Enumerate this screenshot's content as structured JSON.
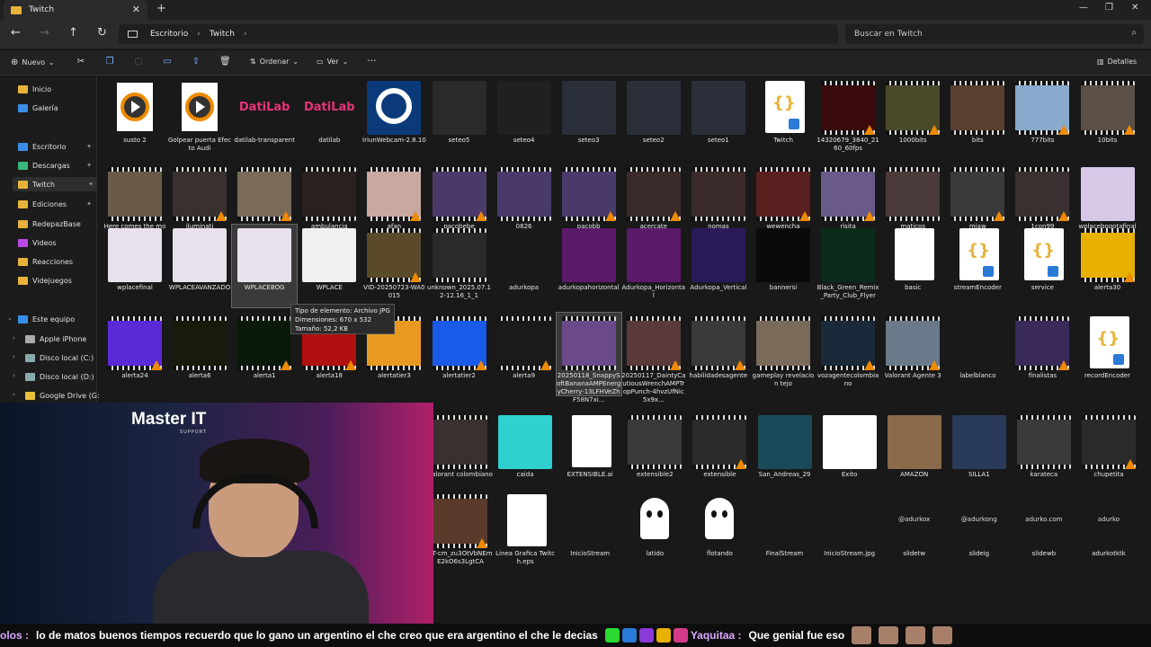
{
  "window": {
    "tab_title": "Twitch",
    "new_tab": "+",
    "close_tab": "✕"
  },
  "address": {
    "breadcrumbs": [
      "Escritorio",
      "Twitch"
    ],
    "search_placeholder": "Buscar en Twitch"
  },
  "toolbar": {
    "new_label": "Nuevo",
    "sort_label": "Ordenar",
    "view_label": "Ver",
    "more_label": "···",
    "details_label": "Detalles"
  },
  "sidebar": {
    "items": [
      {
        "label": "Inicio",
        "color": "#e8b33a"
      },
      {
        "label": "Galería",
        "color": "#3a8ee8"
      },
      {
        "label": "Escritorio",
        "color": "#3a8ee8"
      },
      {
        "label": "Descargas",
        "color": "#3ab87a"
      },
      {
        "label": "Twitch",
        "color": "#e8b33a"
      },
      {
        "label": "Ediciones",
        "color": "#e8b33a"
      },
      {
        "label": "RedepazBase",
        "color": "#e8b33a"
      },
      {
        "label": "Videos",
        "color": "#b94ae8"
      },
      {
        "label": "Reacciones",
        "color": "#e8b33a"
      },
      {
        "label": "Videjuegos",
        "color": "#e8b33a"
      },
      {
        "label": "Este equipo",
        "color": "#3a8ee8"
      },
      {
        "label": "Apple iPhone",
        "color": "#aaa"
      },
      {
        "label": "Disco local (C:)",
        "color": "#8aa"
      },
      {
        "label": "Disco local (D:)",
        "color": "#8aa"
      },
      {
        "label": "Google Drive (G:)",
        "color": "#e8c33a"
      }
    ]
  },
  "files": [
    {
      "name": "susto 2",
      "thumb": "#ffffff",
      "kind": "play"
    },
    {
      "name": "Golpear puerta Efecto Audi",
      "thumb": "#ffffff",
      "kind": "play"
    },
    {
      "name": "datilab-transparent",
      "thumb": "#191919",
      "kind": "datilab"
    },
    {
      "name": "datilab",
      "thumb": "#191919",
      "kind": "datilab"
    },
    {
      "name": "IriunWebcam-2.8.10",
      "thumb": "#0a3a7a",
      "kind": "iriun"
    },
    {
      "name": "seteo5",
      "thumb": "#2a2a2a",
      "kind": "shot"
    },
    {
      "name": "seteo4",
      "thumb": "#202020",
      "kind": "shot"
    },
    {
      "name": "seteo3",
      "thumb": "#2a2f3a",
      "kind": "shot"
    },
    {
      "name": "seteo2",
      "thumb": "#2a2f3a",
      "kind": "shot"
    },
    {
      "name": "seteo1",
      "thumb": "#2a2f3a",
      "kind": "shot"
    },
    {
      "name": "Twitch",
      "thumb": "#ffffff",
      "kind": "json"
    },
    {
      "name": "14320679_3840_2160_60fps",
      "thumb": "#3a0a0a",
      "kind": "video"
    },
    {
      "name": "1000bits",
      "thumb": "#4a4a2a",
      "kind": "video"
    },
    {
      "name": "bits",
      "thumb": "#5a4030",
      "kind": "video"
    },
    {
      "name": "777bits",
      "thumb": "#88aacc",
      "kind": "video"
    },
    {
      "name": "10bits",
      "thumb": "#5a5048",
      "kind": "video"
    },
    {
      "name": "Here comes the money - meme",
      "thumb": "#6a5a4a",
      "kind": "video"
    },
    {
      "name": "iluminati",
      "thumb": "#3a3030",
      "kind": "video"
    },
    {
      "name": "cagada",
      "thumb": "#7a6a5a",
      "kind": "video"
    },
    {
      "name": "ambulancia",
      "thumb": "#2a2020",
      "kind": "video"
    },
    {
      "name": "afan",
      "thumb": "#c8a8a0",
      "kind": "video"
    },
    {
      "name": "pacobebe",
      "thumb": "#4a3a6a",
      "kind": "video"
    },
    {
      "name": "0826",
      "thumb": "#4a3a6a",
      "kind": "video"
    },
    {
      "name": "pacobb",
      "thumb": "#4a3a6a",
      "kind": "video"
    },
    {
      "name": "acercate",
      "thumb": "#3a2a2a",
      "kind": "video"
    },
    {
      "name": "nomas",
      "thumb": "#3a2a2a",
      "kind": "video"
    },
    {
      "name": "wewencha",
      "thumb": "#5a2020",
      "kind": "video"
    },
    {
      "name": "risita",
      "thumb": "#6a5a8a",
      "kind": "video"
    },
    {
      "name": "maticos",
      "thumb": "#4a3a3a",
      "kind": "video"
    },
    {
      "name": "miaw",
      "thumb": "#3a3a3a",
      "kind": "video"
    },
    {
      "name": "1con99",
      "thumb": "#3a3030",
      "kind": "video"
    },
    {
      "name": "wplacebogotafinal",
      "thumb": "#d8c8e8",
      "kind": "image"
    },
    {
      "name": "wplacefinal",
      "thumb": "#e8e0ea",
      "kind": "image"
    },
    {
      "name": "WPLACEAVANZADO",
      "thumb": "#e8e0ea",
      "kind": "image"
    },
    {
      "name": "WPLACEBOG",
      "thumb": "#e8e0ea",
      "kind": "image",
      "selected": true
    },
    {
      "name": "WPLACE",
      "thumb": "#f0f0f0",
      "kind": "image"
    },
    {
      "name": "VID-20250723-WA0015",
      "thumb": "#5a4a2a",
      "kind": "video"
    },
    {
      "name": "unknown_2025.07.12-12.16_1_1",
      "thumb": "#2a2a2a",
      "kind": "video"
    },
    {
      "name": "adurkopa",
      "thumb": "#191919",
      "kind": "image"
    },
    {
      "name": "adurkopahorizontal",
      "thumb": "#5a1a6a",
      "kind": "image"
    },
    {
      "name": "Adurkopa_Horizontal",
      "thumb": "#5a1a6a",
      "kind": "image"
    },
    {
      "name": "Adurkopa_Vertical",
      "thumb": "#2a1a5a",
      "kind": "image"
    },
    {
      "name": "bannersi",
      "thumb": "#0a0a0a",
      "kind": "image"
    },
    {
      "name": "Black_Green_Remix_Party_Club_Flyer",
      "thumb": "#0a2a1a",
      "kind": "image"
    },
    {
      "name": "basic",
      "thumb": "#ffffff",
      "kind": "doc"
    },
    {
      "name": "streamEncoder",
      "thumb": "#ffffff",
      "kind": "json"
    },
    {
      "name": "service",
      "thumb": "#ffffff",
      "kind": "json"
    },
    {
      "name": "alerta30",
      "thumb": "#e8b000",
      "kind": "video"
    },
    {
      "name": "alerta24",
      "thumb": "#5a2ad8",
      "kind": "video"
    },
    {
      "name": "alerta6",
      "thumb": "#1a1a0a",
      "kind": "video"
    },
    {
      "name": "alerta1",
      "thumb": "#0a1a0a",
      "kind": "video"
    },
    {
      "name": "alerta18",
      "thumb": "#b01010",
      "kind": "video"
    },
    {
      "name": "alertatier3",
      "thumb": "#e89a20",
      "kind": "video"
    },
    {
      "name": "alertatier2",
      "thumb": "#1a5ae8",
      "kind": "video"
    },
    {
      "name": "alerta9",
      "thumb": "#1a1a1a",
      "kind": "video"
    },
    {
      "name": "20250118_SnappySoftBananaAMPEnergyCherry-13LFHVeZhF58N7xi...",
      "thumb": "#6a4a8a",
      "kind": "video",
      "selected": true
    },
    {
      "name": "20250117_DaintyCautiousWrenchAMPTropPunch-4hvzUfNic5x9x...",
      "thumb": "#5a3a3a",
      "kind": "video"
    },
    {
      "name": "habilidadesagente",
      "thumb": "#3a3a3a",
      "kind": "video"
    },
    {
      "name": "gameplay revelacion tejo",
      "thumb": "#7a6a5a",
      "kind": "video"
    },
    {
      "name": "vozagentecolombiano",
      "thumb": "#1a2a3a",
      "kind": "video"
    },
    {
      "name": "Valorant Agente 3",
      "thumb": "#6a7a8a",
      "kind": "video"
    },
    {
      "name": "labelblanco",
      "thumb": "#191919",
      "kind": "image"
    },
    {
      "name": "finalistas",
      "thumb": "#3a2a5a",
      "kind": "video"
    },
    {
      "name": "recordEncoder",
      "thumb": "#ffffff",
      "kind": "json"
    },
    {
      "name": "valorant colombiano",
      "thumb": "#3a3030",
      "kind": "video"
    },
    {
      "name": "caida",
      "thumb": "#30d0d0",
      "kind": "image"
    },
    {
      "name": "EXTENSIBLE.ai",
      "thumb": "#ffffff",
      "kind": "doc"
    },
    {
      "name": "extensible2",
      "thumb": "#3a3a3a",
      "kind": "video"
    },
    {
      "name": "extensible",
      "thumb": "#2a2a2a",
      "kind": "video"
    },
    {
      "name": "San_Andreas_29",
      "thumb": "#1a4a5a",
      "kind": "image"
    },
    {
      "name": "Exito",
      "thumb": "#ffffff",
      "kind": "image"
    },
    {
      "name": "AMAZON",
      "thumb": "#8a6a4a",
      "kind": "image"
    },
    {
      "name": "SILLA1",
      "thumb": "#2a3a5a",
      "kind": "image"
    },
    {
      "name": "karateca",
      "thumb": "#3a3a3a",
      "kind": "video"
    },
    {
      "name": "chupetita",
      "thumb": "#2a2a2a",
      "kind": "video"
    },
    {
      "name": "AT-cm_zu3OtVbNEmE2kO6s3LgtCA",
      "thumb": "#5a3a2a",
      "kind": "video"
    },
    {
      "name": "Linea Grafica Twitch.eps",
      "thumb": "#ffffff",
      "kind": "doc"
    },
    {
      "name": "InicioStream",
      "thumb": "#191919",
      "kind": "image"
    },
    {
      "name": "latido",
      "thumb": "#191919",
      "kind": "ghost"
    },
    {
      "name": "flotando",
      "thumb": "#191919",
      "kind": "ghost"
    },
    {
      "name": "FinalStream",
      "thumb": "#191919",
      "kind": "image"
    },
    {
      "name": "InicioStream.jpg",
      "thumb": "#191919",
      "kind": "image"
    },
    {
      "name": "slidetw",
      "thumb": "#191919",
      "kind": "image",
      "caption": "@adurkox"
    },
    {
      "name": "slideig",
      "thumb": "#191919",
      "kind": "image",
      "caption": "@adurkong"
    },
    {
      "name": "slidewb",
      "thumb": "#191919",
      "kind": "image",
      "caption": "adurko.com"
    },
    {
      "name": "adurkotktk",
      "thumb": "#191919",
      "kind": "image",
      "caption": "adurko"
    }
  ],
  "tooltip": {
    "line1": "Tipo de elemento: Archivo JPG",
    "line2": "Dimensiones: 670 x 532",
    "line3": "Tamaño: 52,2 KB"
  },
  "overlay": {
    "brand": "Master IT",
    "brand_sub": "SUPPORT"
  },
  "ticker": {
    "segments": [
      {
        "text": "olos :",
        "user": true
      },
      {
        "text": "lo de matos  buenos tiempos  recuerdo que lo gano un argentino  el che creo que era  argentino el che le decias",
        "user": false
      },
      {
        "text": "Yaquitaa :",
        "user": true
      },
      {
        "text": "Que genial fue eso",
        "user": false
      }
    ]
  }
}
